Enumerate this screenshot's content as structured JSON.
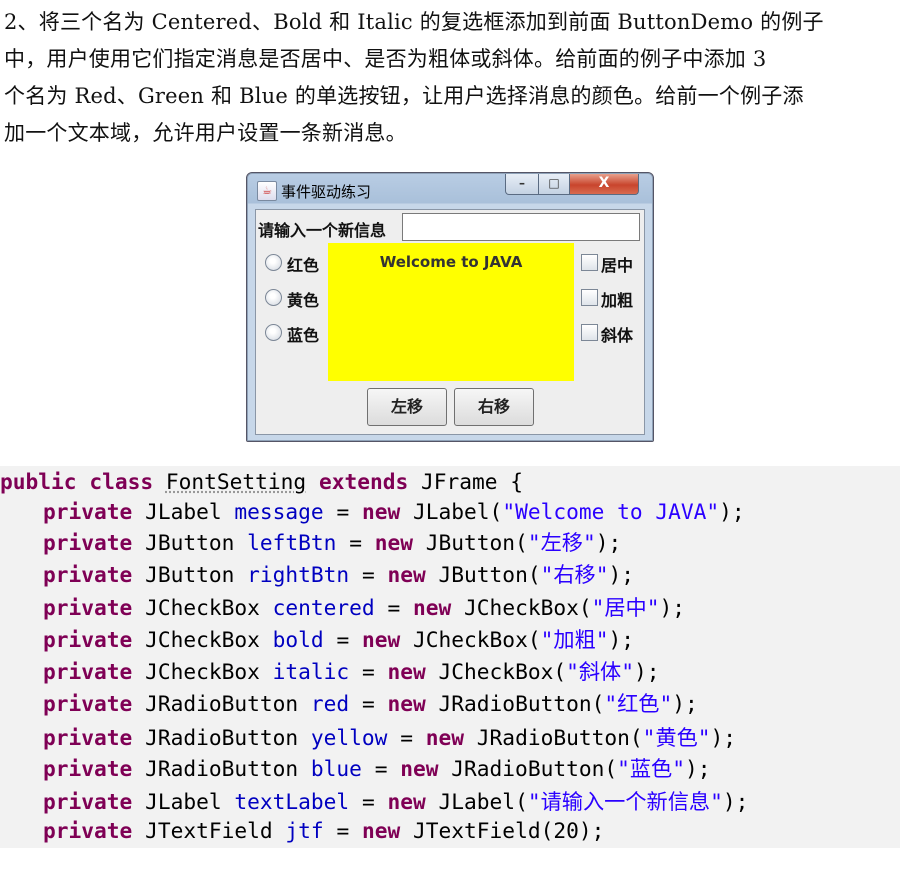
{
  "paragraph": [
    "2、将三个名为 Centered、Bold 和 Italic 的复选框添加到前面 ButtonDemo 的例子",
    "中，用户使用它们指定消息是否居中、是否为粗体或斜体。给前面的例子中添加 3",
    "个名为 Red、Green 和 Blue 的单选按钮，让用户选择消息的颜色。给前一个例子添",
    "加一个文本域，允许用户设置一条新消息。"
  ],
  "window": {
    "title": "事件驱动练习",
    "controls": {
      "minimize": "–",
      "maximize": "□",
      "close": "X"
    },
    "input_label": "请输入一个新信息",
    "input_value": "",
    "radios": [
      "红色",
      "黄色",
      "蓝色"
    ],
    "checkboxes": [
      "居中",
      "加粗",
      "斜体"
    ],
    "message": "Welcome to JAVA",
    "message_bg": "#ffff00",
    "buttons": {
      "left": "左移",
      "right": "右移"
    }
  },
  "code": {
    "header": {
      "kw1": "public",
      "kw2": "class",
      "cls": "FontSetting",
      "kw3": "extends",
      "rest": "JFrame {"
    },
    "lines": [
      {
        "type": "JLabel",
        "name": "message",
        "ctor": "JLabel(",
        "arg": "\"Welcome to JAVA\"",
        "end": ");"
      },
      {
        "type": "JButton",
        "name": "leftBtn",
        "ctor": "JButton(",
        "arg": "\"左移\"",
        "end": ");"
      },
      {
        "type": "JButton",
        "name": "rightBtn",
        "ctor": "JButton(",
        "arg": "\"右移\"",
        "end": ");"
      },
      {
        "type": "JCheckBox",
        "name": "centered",
        "ctor": "JCheckBox(",
        "arg": "\"居中\"",
        "end": ");"
      },
      {
        "type": "JCheckBox",
        "name": "bold",
        "ctor": "JCheckBox(",
        "arg": "\"加粗\"",
        "end": ");"
      },
      {
        "type": "JCheckBox",
        "name": "italic",
        "ctor": "JCheckBox(",
        "arg": "\"斜体\"",
        "end": ");"
      },
      {
        "type": "JRadioButton",
        "name": "red",
        "ctor": "JRadioButton(",
        "arg": "\"红色\"",
        "end": ");"
      },
      {
        "type": "JRadioButton",
        "name": "yellow",
        "ctor": "JRadioButton(",
        "arg": "\"黄色\"",
        "end": ");"
      },
      {
        "type": "JRadioButton",
        "name": "blue",
        "ctor": "JRadioButton(",
        "arg": "\"蓝色\"",
        "end": ");"
      },
      {
        "type": "JLabel",
        "name": "textLabel",
        "ctor": "JLabel(",
        "arg": "\"请输入一个新信息\"",
        "end": ");"
      },
      {
        "type": "JTextField",
        "name": "jtf",
        "ctor": "JTextField(20);",
        "arg": "",
        "end": ""
      }
    ],
    "modifier": "private",
    "assign": "=",
    "new_kw": "new",
    "colors": {
      "keyword": "#7f0055",
      "field": "#0000c0",
      "string": "#2a00ff",
      "background": "#f2f2f2"
    }
  }
}
